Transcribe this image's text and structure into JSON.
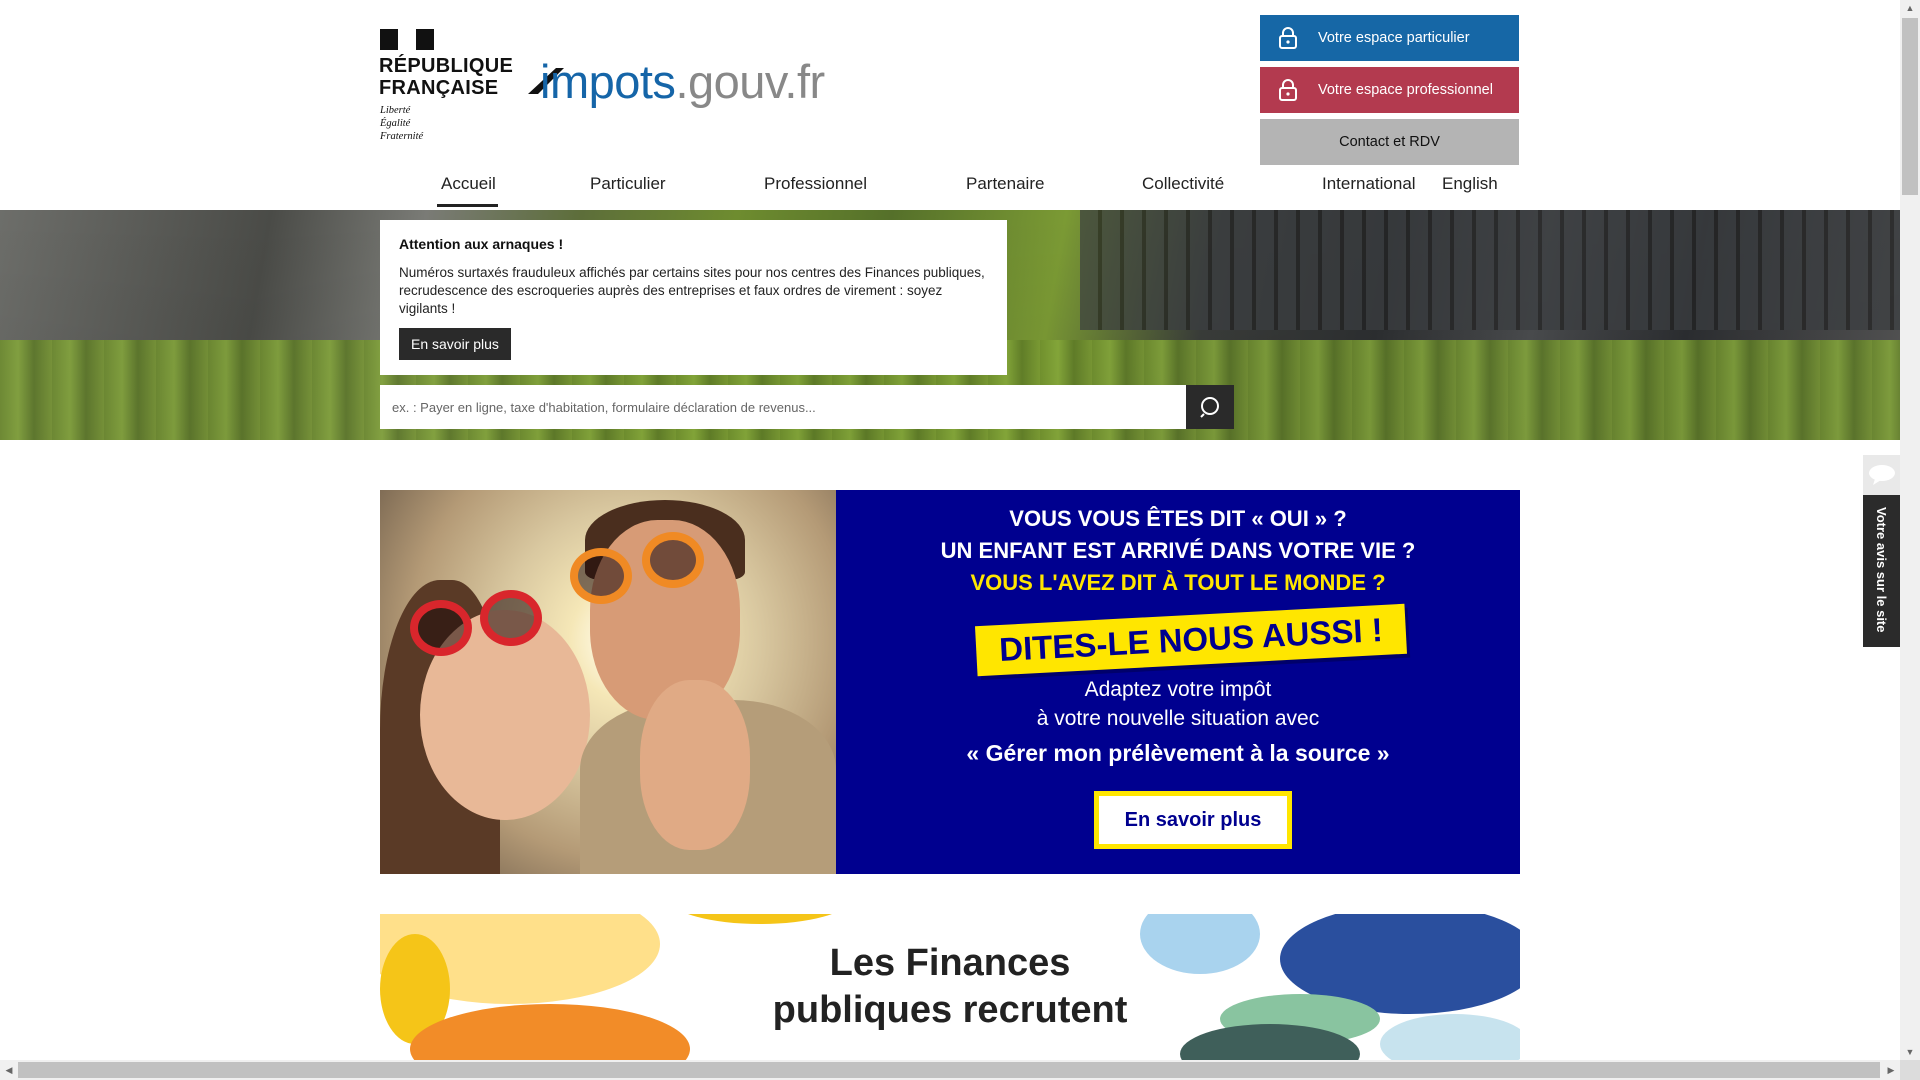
{
  "header": {
    "republique_line1": "RÉPUBLIQUE",
    "republique_line2": "FRANÇAISE",
    "motto_1": "Liberté",
    "motto_2": "Égalité",
    "motto_3": "Fraternité",
    "site_logo_brand": "impots",
    "site_logo_domain": ".gouv.fr",
    "buttons": {
      "particulier": "Votre espace particulier",
      "professionnel": "Votre espace professionnel",
      "contact": "Contact et RDV"
    }
  },
  "nav": {
    "items": [
      "Accueil",
      "Particulier",
      "Professionnel",
      "Partenaire",
      "Collectivité",
      "International",
      "English"
    ],
    "active": "Accueil"
  },
  "alert": {
    "title": "Attention aux arnaques !",
    "text": "Numéros surtaxés frauduleux affichés par certains sites pour nos centres des Finances publiques, recrudescence des escroqueries auprès des entreprises et faux ordres de virement : soyez vigilants !",
    "button": "En savoir plus"
  },
  "search": {
    "placeholder": "ex. : Payer en ligne, taxe d'habitation, formulaire déclaration de revenus...",
    "icon": "search-icon"
  },
  "promo": {
    "line1": "VOUS VOUS ÊTES DIT « OUI » ?",
    "line2": "UN ENFANT EST ARRIVÉ DANS VOTRE VIE ?",
    "line3": "VOUS L'AVEZ DIT À TOUT LE MONDE ?",
    "badge": "DITES-LE NOUS AUSSI !",
    "line4": "Adaptez votre impôt",
    "line5": "à votre nouvelle situation avec",
    "line6": "« Gérer mon prélèvement à la source »",
    "cta": "En savoir plus",
    "colors": {
      "background": "#00008f",
      "accent": "#ffe600"
    }
  },
  "recruit": {
    "title_line1": "Les Finances",
    "title_line2": "publiques recrutent"
  },
  "feedback": {
    "label": "Votre avis sur le site",
    "icon": "speech-bubble-icon"
  },
  "colors": {
    "particulier": "#1667a6",
    "professionnel": "#b33a4f",
    "contact": "#b4b4b4"
  }
}
